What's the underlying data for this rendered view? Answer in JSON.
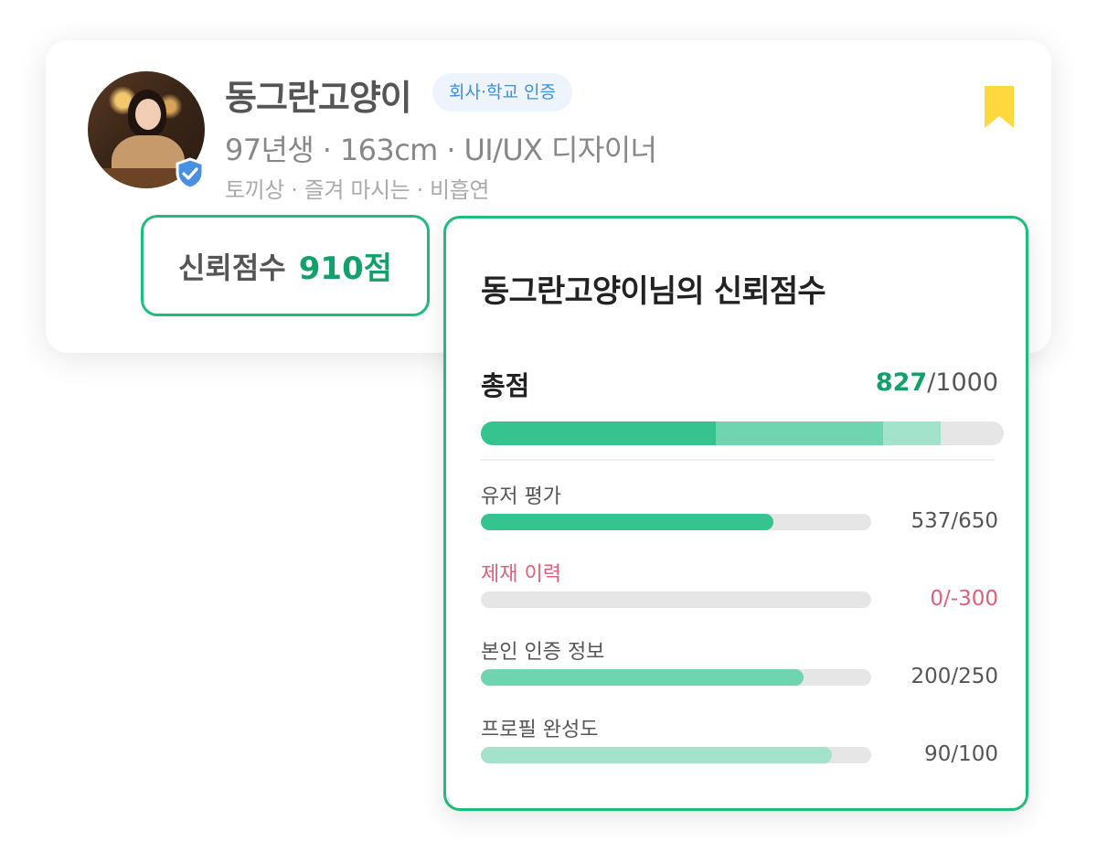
{
  "profile": {
    "name": "동그란고양이",
    "certification_badge": "회사·학교 인증",
    "meta": "97년생 · 163cm · UI/UX 디자이너",
    "tags": "토끼상 · 즐겨 마시는 · 비흡연",
    "verified_icon": "shield-check-icon",
    "bookmark_icon": "bookmark-icon",
    "colors": {
      "verified": "#4a90e2",
      "bookmark": "#ffd83d"
    }
  },
  "trust_chip": {
    "label": "신뢰점수",
    "score": "910점"
  },
  "score_card": {
    "title": "동그란고양이님의 신뢰점수",
    "total": {
      "label": "총점",
      "value": "827",
      "max": "/1000",
      "segments": [
        {
          "name": "유저 평가",
          "fraction": 0.45,
          "color": "#34c48f"
        },
        {
          "name": "본인 인증 정보",
          "fraction": 0.32,
          "color": "#6fd5b0"
        },
        {
          "name": "프로필 완성도",
          "fraction": 0.11,
          "color": "#a3e2cb"
        }
      ]
    },
    "rows": [
      {
        "label": "유저 평가",
        "value": "537/650",
        "fraction": 0.75,
        "color": "#34c48f",
        "warn": false
      },
      {
        "label": "제재 이력",
        "value": "0/-300",
        "fraction": 0,
        "color": "#e0607a",
        "warn": true
      },
      {
        "label": "본인 인증 정보",
        "value": "200/250",
        "fraction": 0.827,
        "color": "#6fd5b0",
        "warn": false
      },
      {
        "label": "프로필 완성도",
        "value": "90/100",
        "fraction": 0.9,
        "color": "#a3e2cb",
        "warn": false
      }
    ],
    "accent_color": "#13a06a",
    "border_color": "#1dbd7c"
  }
}
